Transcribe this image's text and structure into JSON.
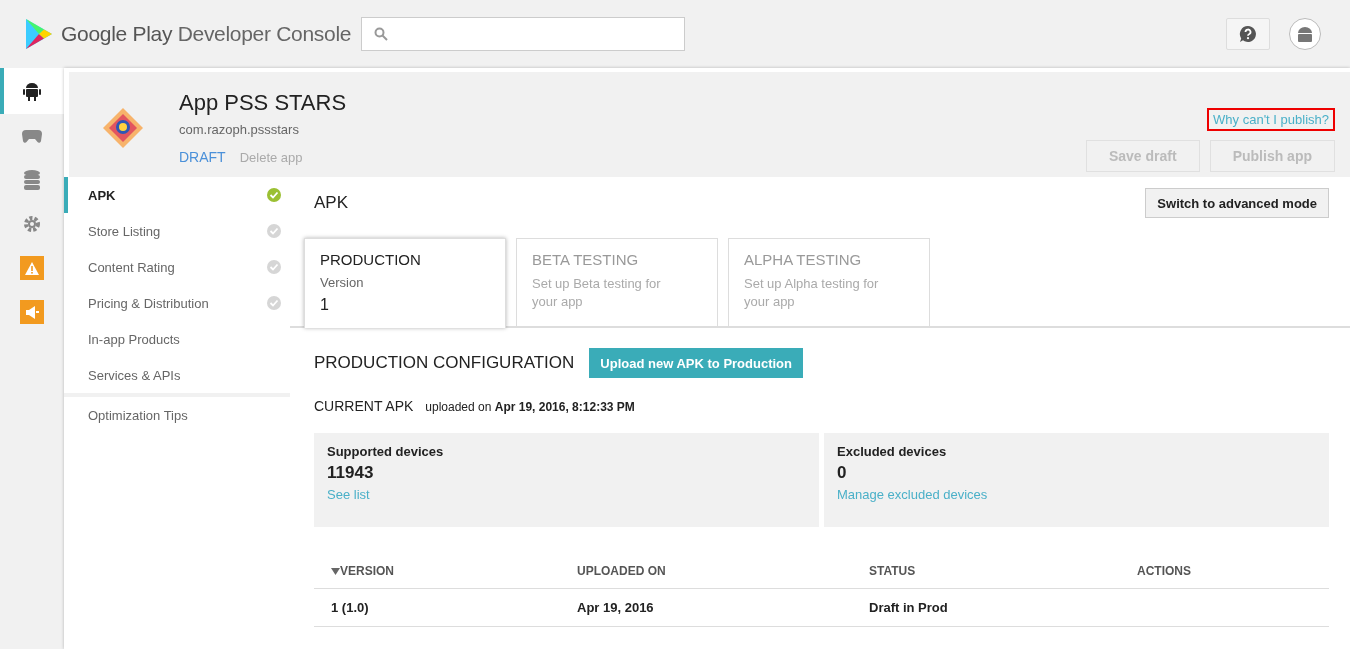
{
  "header": {
    "brand_bold": "Google Play",
    "brand_light": "Developer Console"
  },
  "rail": [
    {
      "selected": true,
      "highlighted": false
    },
    {
      "selected": false,
      "highlighted": false
    },
    {
      "selected": false,
      "highlighted": false
    },
    {
      "selected": false,
      "highlighted": false
    },
    {
      "selected": false,
      "highlighted": true
    },
    {
      "selected": false,
      "highlighted": true
    }
  ],
  "app": {
    "title": "App PSS STARS",
    "package": "com.razoph.pssstars",
    "status": "DRAFT",
    "delete": "Delete app",
    "why_link": "Why can't I publish?",
    "buttons": [
      {
        "label": "Save draft",
        "disabled": true
      },
      {
        "label": "Publish app",
        "disabled": true
      }
    ]
  },
  "nav": [
    {
      "label": "APK",
      "selected": true,
      "kind": "task",
      "checked": true
    },
    {
      "label": "Store Listing",
      "selected": false,
      "kind": "task",
      "checked": false
    },
    {
      "label": "Content Rating",
      "selected": false,
      "kind": "task",
      "checked": false
    },
    {
      "label": "Pricing & Distribution",
      "selected": false,
      "kind": "task",
      "checked": false
    },
    {
      "label": "In-app Products",
      "selected": false,
      "kind": "plain"
    },
    {
      "label": "Services & APIs",
      "selected": false,
      "kind": "plain"
    }
  ],
  "nav_footer": "Optimization Tips",
  "page_title": "APK",
  "mode_button": "Switch to advanced mode",
  "tracks": [
    {
      "title": "PRODUCTION",
      "selected": true,
      "kind": "version",
      "label": "Version",
      "value": "1"
    },
    {
      "title": "BETA TESTING",
      "selected": false,
      "kind": "setup",
      "description": "Set up Beta testing for your app"
    },
    {
      "title": "ALPHA TESTING",
      "selected": false,
      "kind": "setup",
      "description": "Set up Alpha testing for your app"
    }
  ],
  "config": {
    "title": "PRODUCTION CONFIGURATION",
    "upload_button": "Upload new APK to Production"
  },
  "current_apk": {
    "label": "CURRENT APK",
    "uploaded_prefix": "uploaded on",
    "uploaded_date": "Apr 19, 2016, 8:12:33 PM"
  },
  "device_cards": [
    {
      "title": "Supported devices",
      "count": "11943",
      "link": "See list"
    },
    {
      "title": "Excluded devices",
      "count": "0",
      "link": "Manage excluded devices"
    }
  ],
  "table": {
    "columns": [
      {
        "label": "VERSION",
        "sorted": true
      },
      {
        "label": "UPLOADED ON",
        "sorted": false
      },
      {
        "label": "STATUS",
        "sorted": false
      },
      {
        "label": "ACTIONS",
        "sorted": false
      }
    ],
    "rows": [
      [
        "1 (1.0)",
        "Apr 19, 2016",
        "Draft in Prod",
        ""
      ]
    ]
  }
}
